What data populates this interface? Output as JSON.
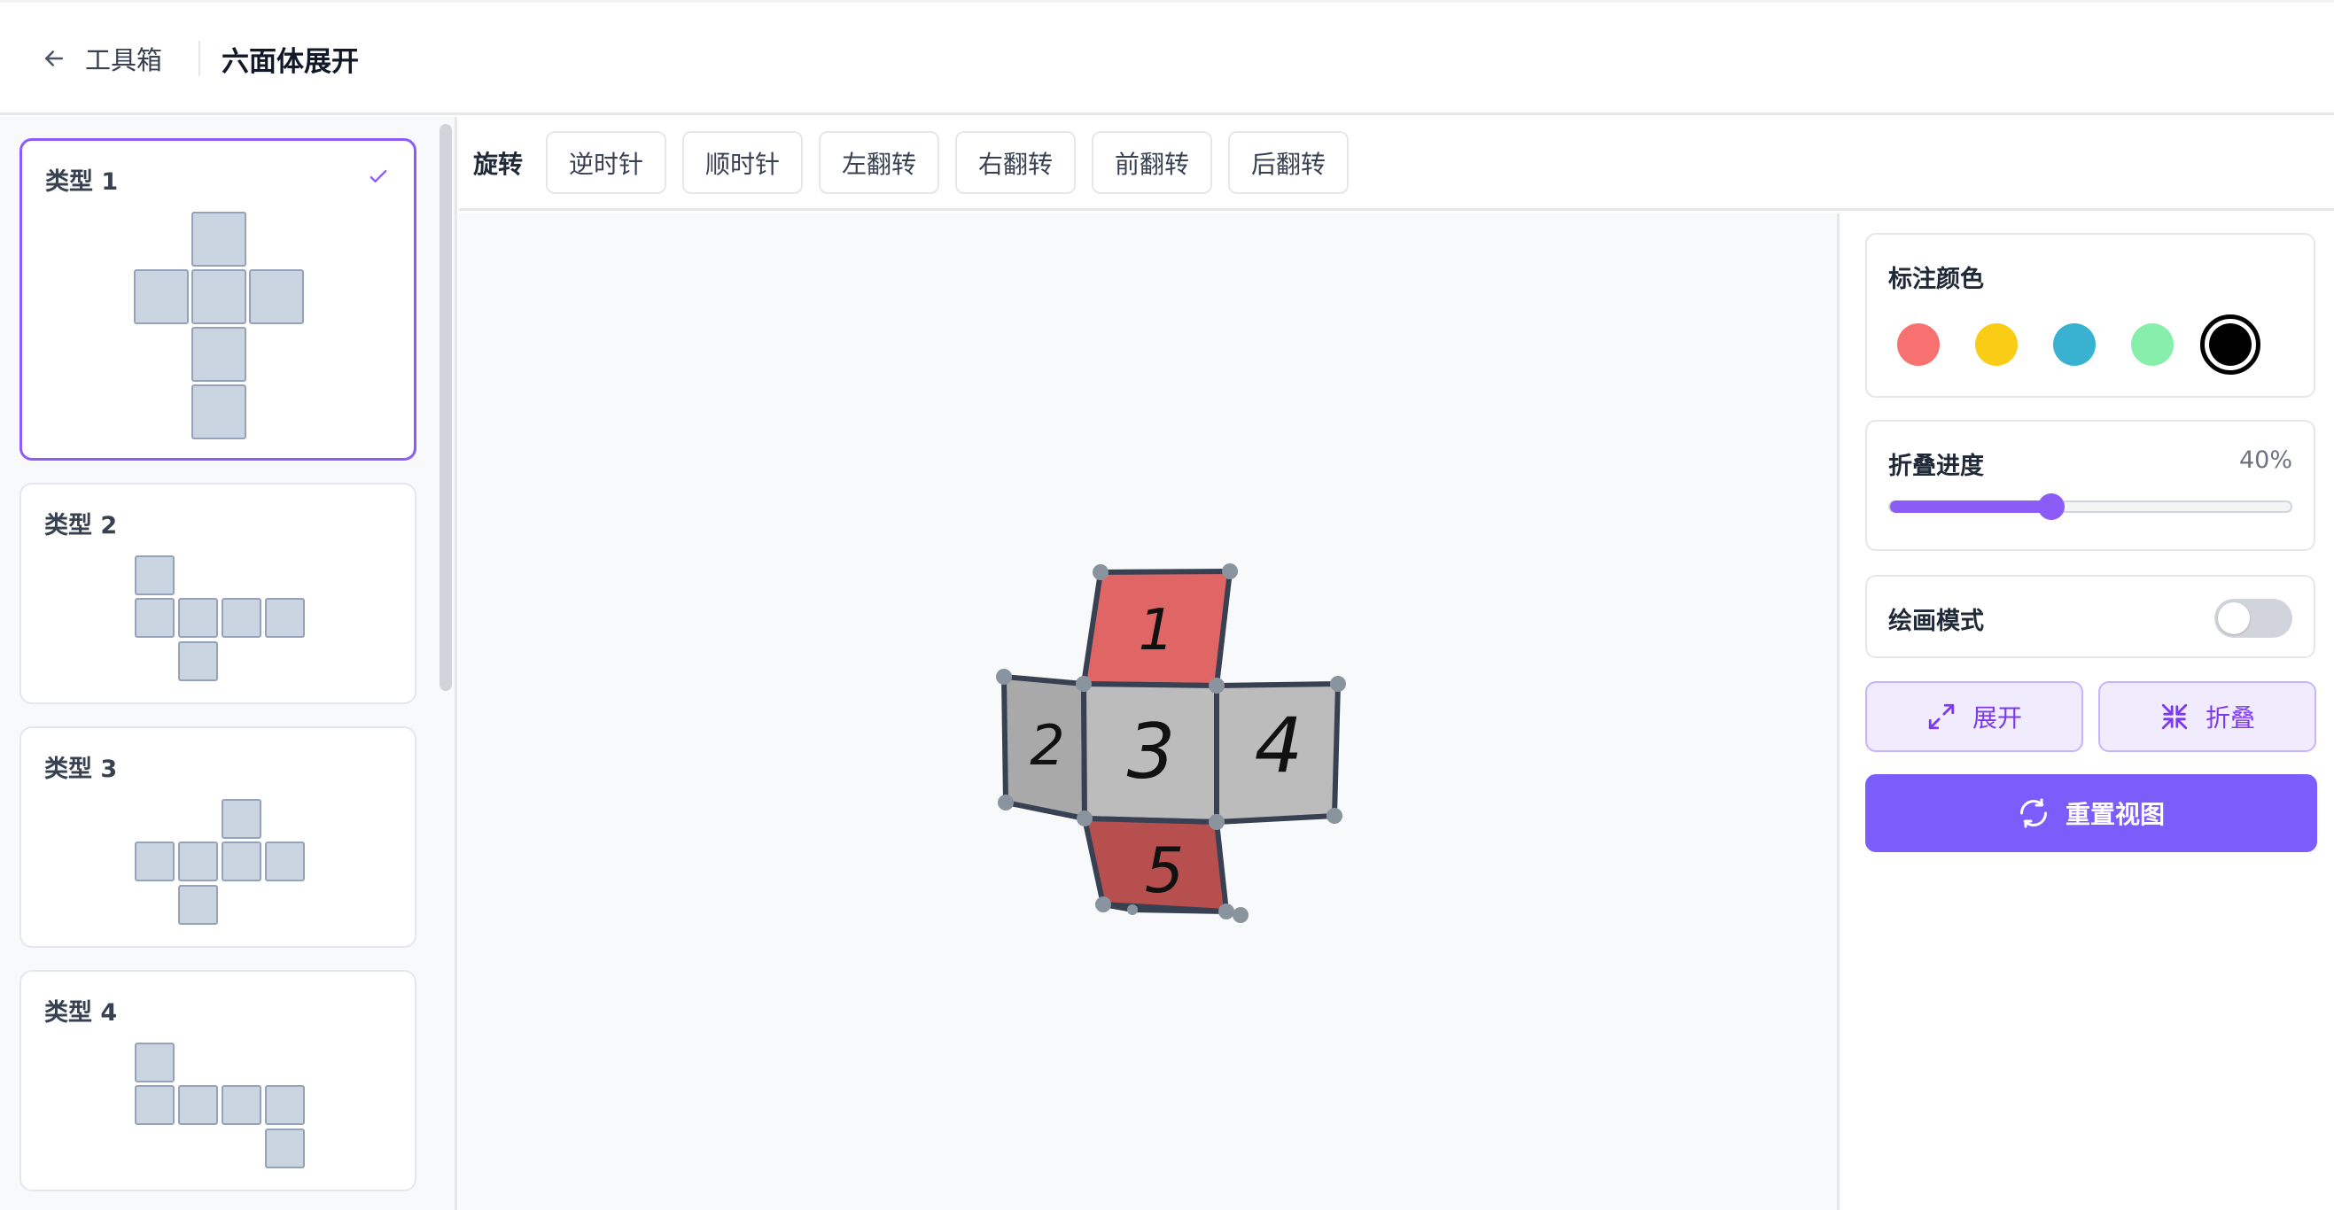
{
  "header": {
    "back_label": "工具箱",
    "title": "六面体展开"
  },
  "sidebar": {
    "nets": [
      {
        "label": "类型 1",
        "selected": true
      },
      {
        "label": "类型 2",
        "selected": false
      },
      {
        "label": "类型 3",
        "selected": false
      },
      {
        "label": "类型 4",
        "selected": false
      }
    ]
  },
  "toolbar": {
    "label": "旋转",
    "buttons": [
      "逆时针",
      "顺时针",
      "左翻转",
      "右翻转",
      "前翻转",
      "后翻转"
    ]
  },
  "canvas": {
    "faces": [
      {
        "number": "1",
        "fill": "#e06666"
      },
      {
        "number": "2",
        "fill": "#a9a9a9"
      },
      {
        "number": "3",
        "fill": "#bcbcbc"
      },
      {
        "number": "4",
        "fill": "#bcbcbc"
      },
      {
        "number": "5",
        "fill": "#b84f4f"
      }
    ]
  },
  "panel": {
    "color_title": "标注颜色",
    "colors": [
      "#f87171",
      "#facc15",
      "#38b2d0",
      "#86efac",
      "#000000"
    ],
    "selected_color": "#000000",
    "progress_title": "折叠进度",
    "progress_value": "40%",
    "progress_fraction": 0.4,
    "draw_mode_title": "绘画模式",
    "draw_mode_on": false,
    "expand_label": "展开",
    "fold_label": "折叠",
    "reset_label": "重置视图"
  },
  "colors": {
    "accent": "#7c5cfa",
    "accent_light": "#f0ecfe",
    "face_tile": "#cbd5e1"
  }
}
